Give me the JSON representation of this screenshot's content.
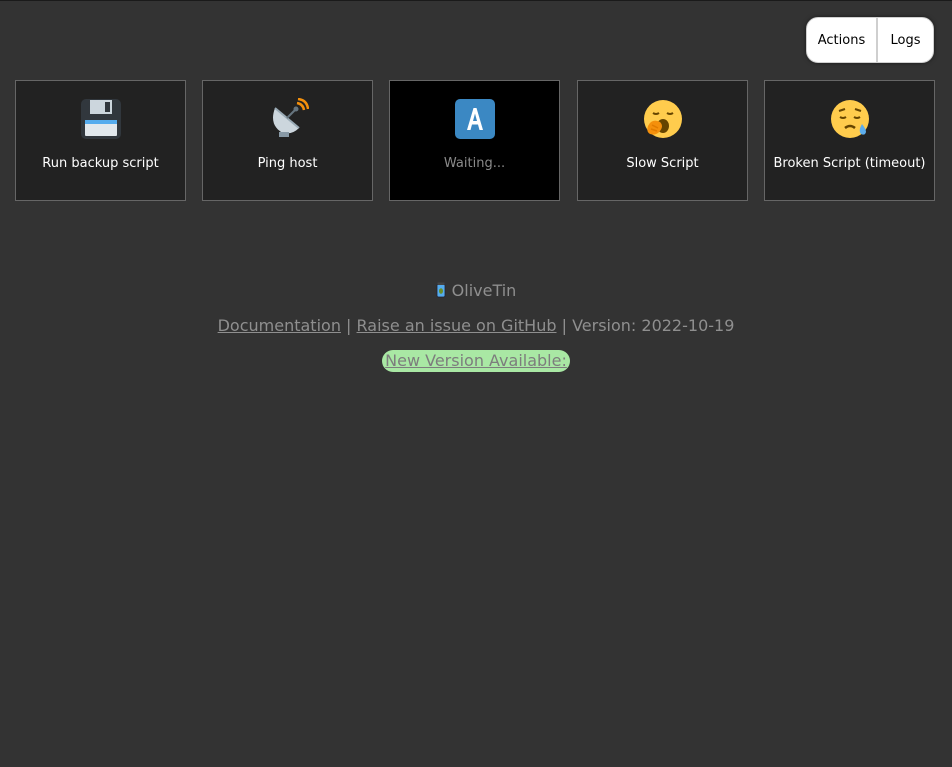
{
  "nav": {
    "actions_label": "Actions",
    "logs_label": "Logs"
  },
  "actions": [
    {
      "label": "Run backup script",
      "icon": "floppy-disk-icon",
      "state": "idle"
    },
    {
      "label": "Ping host",
      "icon": "satellite-antenna-icon",
      "state": "idle"
    },
    {
      "label": "Waiting...",
      "icon": "letter-a-icon",
      "state": "waiting"
    },
    {
      "label": "Slow Script",
      "icon": "yawning-face-icon",
      "state": "idle"
    },
    {
      "label": "Broken Script (timeout)",
      "icon": "sleepy-face-icon",
      "state": "idle"
    }
  ],
  "footer": {
    "app_name": "OliveTin",
    "app_icon": "olive-jar-icon",
    "documentation_label": "Documentation",
    "separator": "|",
    "github_label": "Raise an issue on GitHub",
    "version_text": "Version: 2022-10-19",
    "new_version_label": "New Version Available:"
  },
  "colors": {
    "background": "#333333",
    "button_background": "#222222",
    "waiting_background": "#000000",
    "new_version_badge": "#a9e8a4"
  }
}
